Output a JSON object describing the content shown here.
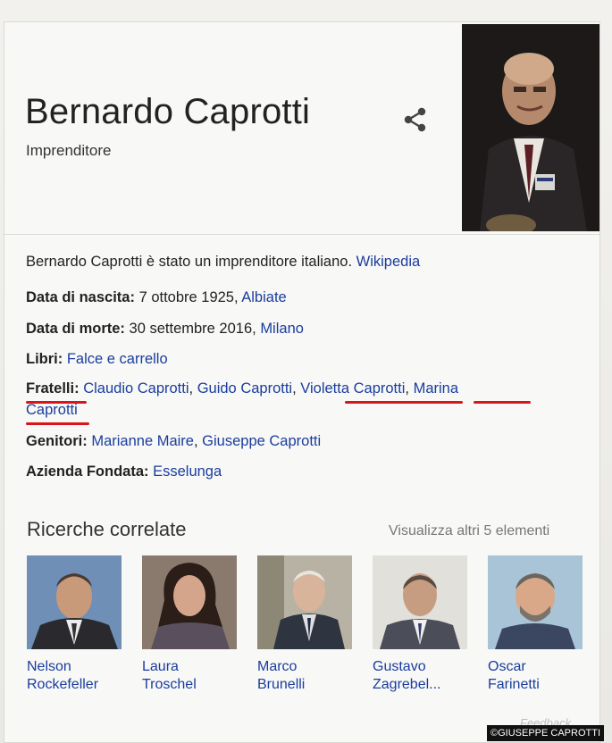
{
  "entity": {
    "name": "Bernardo Caprotti",
    "type": "Imprenditore"
  },
  "description": {
    "text": "Bernardo Caprotti è stato un imprenditore italiano.",
    "source": "Wikipedia"
  },
  "facts": {
    "birth": {
      "label": "Data di nascita:",
      "value": "7 ottobre 1925,",
      "link": "Albiate"
    },
    "death": {
      "label": "Data di morte:",
      "value": "30 settembre 2016,",
      "link": "Milano"
    },
    "books": {
      "label": "Libri:",
      "link": "Falce e carrello"
    },
    "siblings": {
      "label": "Fratelli:",
      "items": [
        "Claudio Caprotti",
        "Guido Caprotti",
        "Violetta Caprotti",
        "Marina",
        "Caprotti"
      ],
      "separator": ","
    },
    "parents": {
      "label": "Genitori:",
      "items": [
        "Marianne Maire",
        "Giuseppe Caprotti"
      ],
      "separator": ","
    },
    "company": {
      "label": "Azienda Fondata:",
      "link": "Esselunga"
    }
  },
  "related": {
    "title": "Ricerche correlate",
    "more": "Visualizza altri 5 elementi",
    "people": [
      {
        "line1": "Nelson",
        "line2": "Rockefeller"
      },
      {
        "line1": "Laura",
        "line2": "Troschel"
      },
      {
        "line1": "Marco",
        "line2": "Brunelli"
      },
      {
        "line1": "Gustavo",
        "line2": "Zagrebel..."
      },
      {
        "line1": "Oscar",
        "line2": "Farinetti"
      }
    ]
  },
  "feedback": "Feedback",
  "watermark": "©GIUSEPPE CAPROTTI",
  "icons": {
    "share": "share-icon"
  },
  "colors": {
    "link": "#1a3d9e",
    "annotation": "#d9141b",
    "muted": "#777777"
  }
}
